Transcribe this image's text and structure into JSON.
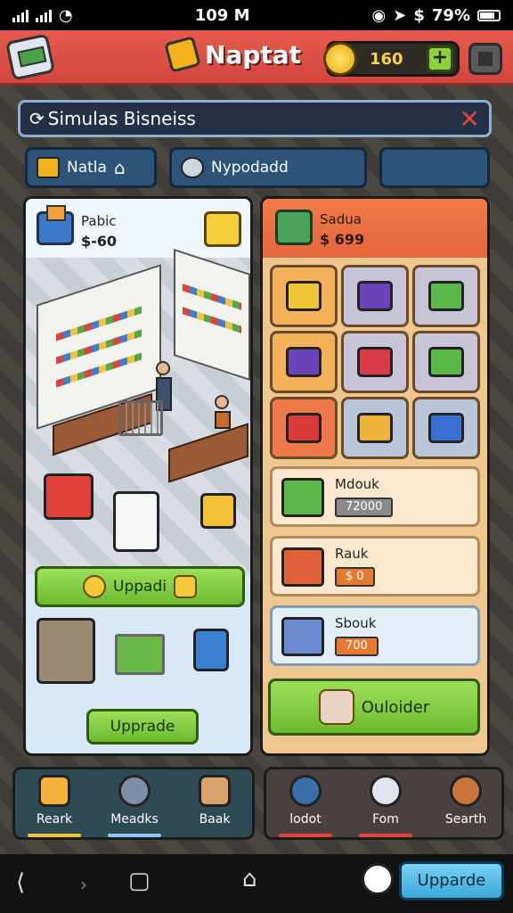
{
  "status_bar": {
    "time": "109 M",
    "battery": "79%"
  },
  "header": {
    "title": "Naptat",
    "coins": "160",
    "add_symbol": "+"
  },
  "search": {
    "text": "Simulas Bisneiss",
    "close_symbol": "✕"
  },
  "tabs": [
    {
      "label": "Natla"
    },
    {
      "label": "Nypodadd"
    },
    {
      "label": ""
    }
  ],
  "left_panel": {
    "name": "Pabic",
    "price": "$-60",
    "upgrade_label": "Uppadi",
    "upgrade2_label": "Upprade"
  },
  "right_panel": {
    "name": "Sadua",
    "price": "$ 699",
    "items": [
      {
        "name": "Mdouk",
        "value": "72000",
        "color": "#8a8a8a"
      },
      {
        "name": "Rauk",
        "value": "$ 0",
        "color": "#e67a30"
      },
      {
        "name": "Sbouk",
        "value": "700",
        "color": "#e67a30"
      }
    ],
    "main_button_label": "Ouloider"
  },
  "dock_left": [
    {
      "label": "Reark",
      "underline": "#f3c23a"
    },
    {
      "label": "Meadks",
      "underline": "#8fc6f0"
    },
    {
      "label": "Baak",
      "underline": ""
    }
  ],
  "dock_right": [
    {
      "label": "lodot",
      "underline": "#e5443a"
    },
    {
      "label": "Fom",
      "underline": "#e5443a"
    },
    {
      "label": "Searth",
      "underline": ""
    }
  ],
  "navbar": {
    "upgrade_label": "Upparde"
  }
}
